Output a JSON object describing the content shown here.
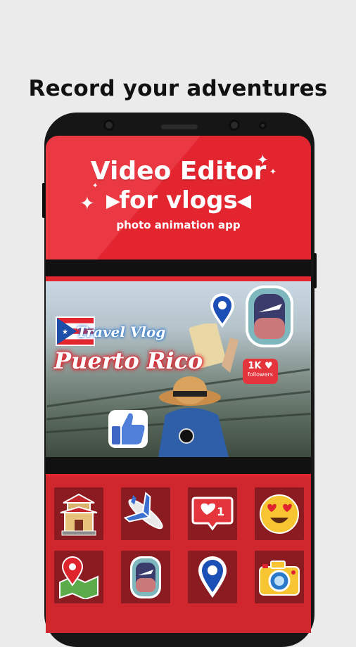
{
  "headline": "Record your adventures",
  "banner": {
    "title_line1": "Video Editor",
    "title_line2": "for vlogs",
    "subtitle": "photo animation app"
  },
  "preview": {
    "sticker_travel_vlog": "Travel Vlog",
    "sticker_location": "Puerto Rico",
    "followers_count": "1K",
    "followers_label": "followers"
  },
  "stickers": [
    {
      "icon": "pagoda-icon"
    },
    {
      "icon": "airplane-icon"
    },
    {
      "icon": "like-notification-icon",
      "count": "1"
    },
    {
      "icon": "heart-eyes-emoji-icon"
    },
    {
      "icon": "map-pin-icon"
    },
    {
      "icon": "airplane-window-icon"
    },
    {
      "icon": "location-pin-icon"
    },
    {
      "icon": "camera-icon"
    }
  ],
  "colors": {
    "brand_red": "#e32530",
    "dark_cell": "#8a1b20",
    "phone_body": "#161616"
  }
}
